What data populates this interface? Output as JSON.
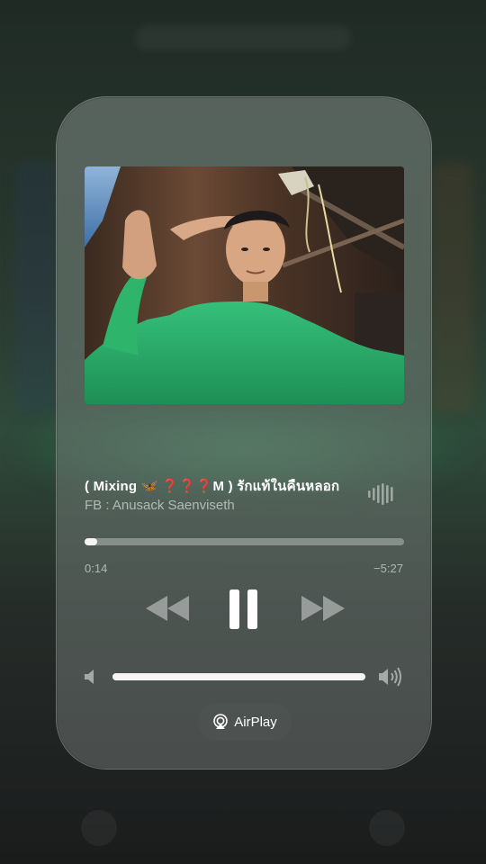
{
  "now_playing": {
    "title": "( Mixing 🦋 ❓❓❓M ) รักแท้ในคืนหลอก",
    "artist": "FB : Anusack Saenviseth",
    "progress_fraction": 0.04,
    "time_elapsed": "0:14",
    "time_remaining": "−5:27"
  },
  "volume": {
    "level_fraction": 1.0
  },
  "controls": {
    "rewind_icon": "rewind-icon",
    "pause_icon": "pause-icon",
    "forward_icon": "fast-forward-icon"
  },
  "airplay": {
    "label": "AirPlay",
    "icon": "airplay-icon"
  },
  "colors": {
    "accent": "#ffffff",
    "card_tint": "#738079",
    "glow_green": "#46b46e",
    "artwork_shirt": "#2fb46b"
  }
}
